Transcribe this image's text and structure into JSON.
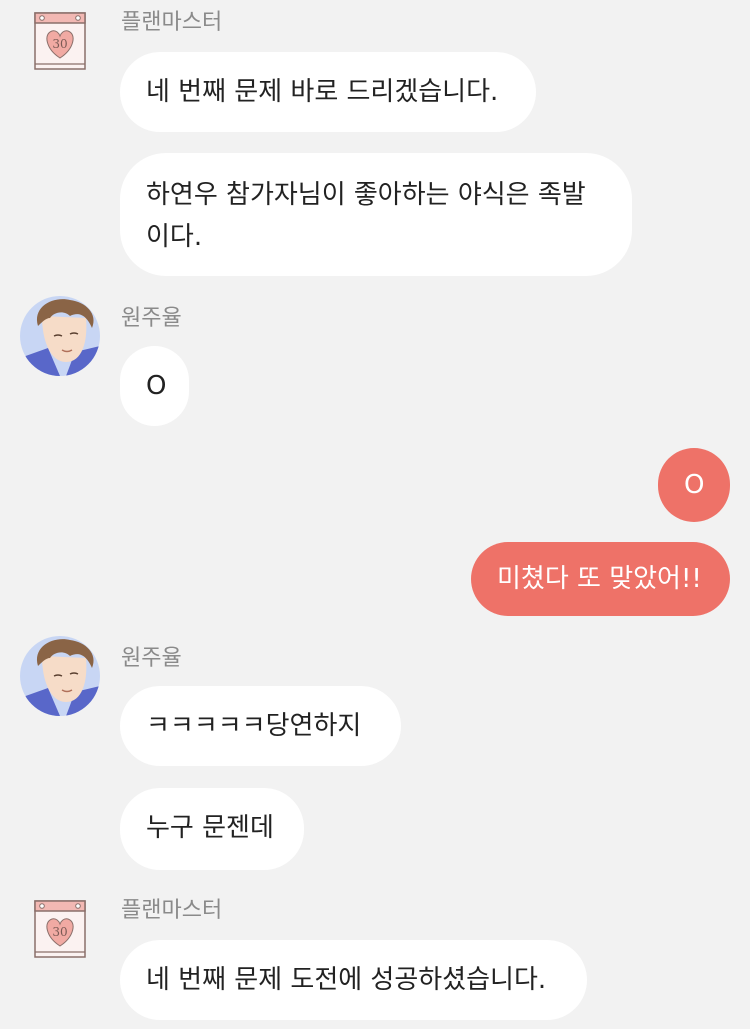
{
  "colors": {
    "background": "#f2f2f2",
    "incoming_bubble": "#ffffff",
    "outgoing_bubble": "#ee7268",
    "sender_name": "#8a8a8a"
  },
  "senders": {
    "planmaster": "플랜마스터",
    "wonjuyul": "원주율"
  },
  "icons": {
    "planmaster_avatar": "heart-calendar-icon",
    "calendar_number": "30",
    "wonjuyul_avatar": "boy-portrait-avatar"
  },
  "messages": [
    {
      "from": "planmaster",
      "text": "네 번째 문제 바로 드리겠습니다."
    },
    {
      "from": "planmaster",
      "text": "하연우 참가자님이 좋아하는 야식은 족발이다."
    },
    {
      "from": "wonjuyul",
      "text": "O"
    },
    {
      "from": "me",
      "text": "O"
    },
    {
      "from": "me",
      "text": "미쳤다 또 맞았어!!"
    },
    {
      "from": "wonjuyul",
      "text": "ㅋㅋㅋㅋㅋ당연하지"
    },
    {
      "from": "wonjuyul",
      "text": "누구 문젠데"
    },
    {
      "from": "planmaster",
      "text": "네 번째 문제 도전에 성공하셨습니다."
    }
  ]
}
